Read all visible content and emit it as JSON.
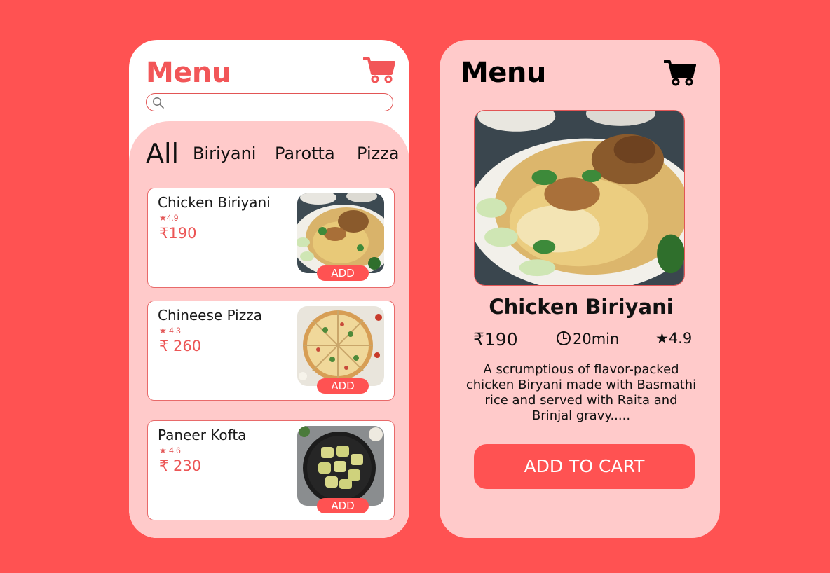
{
  "colors": {
    "background": "#ff5252",
    "accent": "#ff5252",
    "panel_pink": "#ffcaca",
    "title_red": "#f25658"
  },
  "list_screen": {
    "title": "Menu",
    "cart_icon": "cart-icon",
    "search": {
      "value": "",
      "placeholder": "",
      "icon": "search-icon"
    },
    "categories": [
      "All",
      "Biriyani",
      "Parotta",
      "Pizza"
    ],
    "items": [
      {
        "name": "Chicken Biriyani",
        "rating": "★4.9",
        "price": "₹190",
        "button": "ADD"
      },
      {
        "name": "Chineese Pizza",
        "rating": "★ 4.3",
        "price": "₹ 260",
        "button": "ADD"
      },
      {
        "name": "Paneer Kofta",
        "rating": "★ 4.6",
        "price": "₹ 230",
        "button": "ADD"
      }
    ]
  },
  "detail_screen": {
    "title": "Menu",
    "cart_icon": "cart-icon",
    "dish_name": "Chicken Biriyani",
    "price": "₹190",
    "time": "20min",
    "rating": "★4.9",
    "description": "A scrumptious of flavor-packed chicken Biryani made with Basmathi rice and served with Raita and Brinjal gravy.....",
    "cta": "ADD TO CART"
  }
}
